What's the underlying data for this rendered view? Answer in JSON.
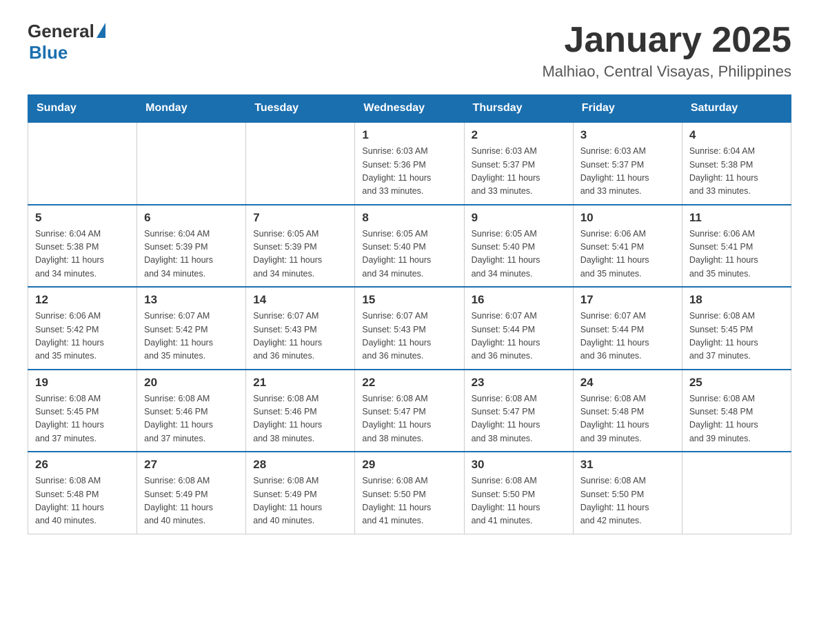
{
  "header": {
    "logo_general": "General",
    "logo_blue": "Blue",
    "month": "January 2025",
    "location": "Malhiao, Central Visayas, Philippines"
  },
  "days_of_week": [
    "Sunday",
    "Monday",
    "Tuesday",
    "Wednesday",
    "Thursday",
    "Friday",
    "Saturday"
  ],
  "weeks": [
    [
      {
        "day": "",
        "info": ""
      },
      {
        "day": "",
        "info": ""
      },
      {
        "day": "",
        "info": ""
      },
      {
        "day": "1",
        "info": "Sunrise: 6:03 AM\nSunset: 5:36 PM\nDaylight: 11 hours\nand 33 minutes."
      },
      {
        "day": "2",
        "info": "Sunrise: 6:03 AM\nSunset: 5:37 PM\nDaylight: 11 hours\nand 33 minutes."
      },
      {
        "day": "3",
        "info": "Sunrise: 6:03 AM\nSunset: 5:37 PM\nDaylight: 11 hours\nand 33 minutes."
      },
      {
        "day": "4",
        "info": "Sunrise: 6:04 AM\nSunset: 5:38 PM\nDaylight: 11 hours\nand 33 minutes."
      }
    ],
    [
      {
        "day": "5",
        "info": "Sunrise: 6:04 AM\nSunset: 5:38 PM\nDaylight: 11 hours\nand 34 minutes."
      },
      {
        "day": "6",
        "info": "Sunrise: 6:04 AM\nSunset: 5:39 PM\nDaylight: 11 hours\nand 34 minutes."
      },
      {
        "day": "7",
        "info": "Sunrise: 6:05 AM\nSunset: 5:39 PM\nDaylight: 11 hours\nand 34 minutes."
      },
      {
        "day": "8",
        "info": "Sunrise: 6:05 AM\nSunset: 5:40 PM\nDaylight: 11 hours\nand 34 minutes."
      },
      {
        "day": "9",
        "info": "Sunrise: 6:05 AM\nSunset: 5:40 PM\nDaylight: 11 hours\nand 34 minutes."
      },
      {
        "day": "10",
        "info": "Sunrise: 6:06 AM\nSunset: 5:41 PM\nDaylight: 11 hours\nand 35 minutes."
      },
      {
        "day": "11",
        "info": "Sunrise: 6:06 AM\nSunset: 5:41 PM\nDaylight: 11 hours\nand 35 minutes."
      }
    ],
    [
      {
        "day": "12",
        "info": "Sunrise: 6:06 AM\nSunset: 5:42 PM\nDaylight: 11 hours\nand 35 minutes."
      },
      {
        "day": "13",
        "info": "Sunrise: 6:07 AM\nSunset: 5:42 PM\nDaylight: 11 hours\nand 35 minutes."
      },
      {
        "day": "14",
        "info": "Sunrise: 6:07 AM\nSunset: 5:43 PM\nDaylight: 11 hours\nand 36 minutes."
      },
      {
        "day": "15",
        "info": "Sunrise: 6:07 AM\nSunset: 5:43 PM\nDaylight: 11 hours\nand 36 minutes."
      },
      {
        "day": "16",
        "info": "Sunrise: 6:07 AM\nSunset: 5:44 PM\nDaylight: 11 hours\nand 36 minutes."
      },
      {
        "day": "17",
        "info": "Sunrise: 6:07 AM\nSunset: 5:44 PM\nDaylight: 11 hours\nand 36 minutes."
      },
      {
        "day": "18",
        "info": "Sunrise: 6:08 AM\nSunset: 5:45 PM\nDaylight: 11 hours\nand 37 minutes."
      }
    ],
    [
      {
        "day": "19",
        "info": "Sunrise: 6:08 AM\nSunset: 5:45 PM\nDaylight: 11 hours\nand 37 minutes."
      },
      {
        "day": "20",
        "info": "Sunrise: 6:08 AM\nSunset: 5:46 PM\nDaylight: 11 hours\nand 37 minutes."
      },
      {
        "day": "21",
        "info": "Sunrise: 6:08 AM\nSunset: 5:46 PM\nDaylight: 11 hours\nand 38 minutes."
      },
      {
        "day": "22",
        "info": "Sunrise: 6:08 AM\nSunset: 5:47 PM\nDaylight: 11 hours\nand 38 minutes."
      },
      {
        "day": "23",
        "info": "Sunrise: 6:08 AM\nSunset: 5:47 PM\nDaylight: 11 hours\nand 38 minutes."
      },
      {
        "day": "24",
        "info": "Sunrise: 6:08 AM\nSunset: 5:48 PM\nDaylight: 11 hours\nand 39 minutes."
      },
      {
        "day": "25",
        "info": "Sunrise: 6:08 AM\nSunset: 5:48 PM\nDaylight: 11 hours\nand 39 minutes."
      }
    ],
    [
      {
        "day": "26",
        "info": "Sunrise: 6:08 AM\nSunset: 5:48 PM\nDaylight: 11 hours\nand 40 minutes."
      },
      {
        "day": "27",
        "info": "Sunrise: 6:08 AM\nSunset: 5:49 PM\nDaylight: 11 hours\nand 40 minutes."
      },
      {
        "day": "28",
        "info": "Sunrise: 6:08 AM\nSunset: 5:49 PM\nDaylight: 11 hours\nand 40 minutes."
      },
      {
        "day": "29",
        "info": "Sunrise: 6:08 AM\nSunset: 5:50 PM\nDaylight: 11 hours\nand 41 minutes."
      },
      {
        "day": "30",
        "info": "Sunrise: 6:08 AM\nSunset: 5:50 PM\nDaylight: 11 hours\nand 41 minutes."
      },
      {
        "day": "31",
        "info": "Sunrise: 6:08 AM\nSunset: 5:50 PM\nDaylight: 11 hours\nand 42 minutes."
      },
      {
        "day": "",
        "info": ""
      }
    ]
  ]
}
